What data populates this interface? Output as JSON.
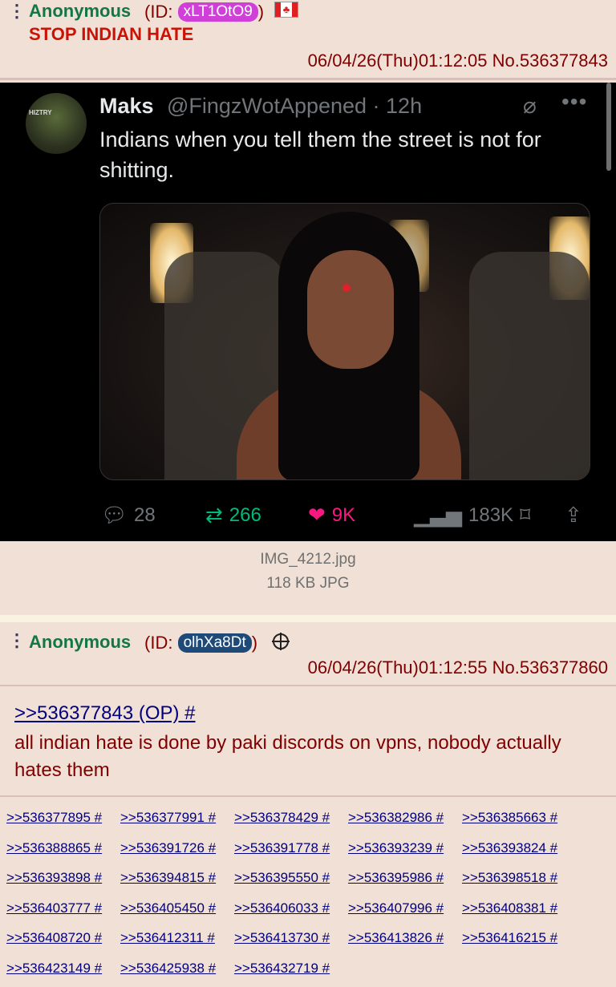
{
  "post1": {
    "menu": "⋮",
    "name": "Anonymous",
    "id_prefix": "(ID: ",
    "id": "xLT1OtO9",
    "id_suffix": ")",
    "id_color": "#d040d8",
    "flag": "Canada",
    "subject": "STOP INDIAN HATE",
    "datetime": "06/04/26(Thu)01:12:05",
    "number": "No.536377843",
    "file": {
      "name": "IMG_4212.jpg",
      "size": "118 KB JPG"
    },
    "tweet": {
      "name": "Maks",
      "handle": "@FingzWotAppened · 12h",
      "text": "Indians when you tell them the street is not for shitting.",
      "avatar_text": "HIZTRY",
      "replies": "28",
      "reposts": "266",
      "likes": "9K",
      "views": "183K",
      "like_color": "#f91880",
      "repost_color": "#00ba7c"
    }
  },
  "post2": {
    "menu": "⋮",
    "name": "Anonymous",
    "id_prefix": "(ID: ",
    "id": "olhXa8Dt",
    "id_suffix": ")",
    "id_color": "#1e4a7a",
    "datetime": "06/04/26(Thu)01:12:55",
    "number": "No.536377860",
    "quote": ">>536377843 (OP) #",
    "message": "all indian hate is done by paki discords on vpns, nobody actually hates them",
    "backlinks": [
      ">>536377895 #",
      ">>536377991 #",
      ">>536378429 #",
      ">>536382986 #",
      ">>536385663 #",
      ">>536388865 #",
      ">>536391726 #",
      ">>536391778 #",
      ">>536393239 #",
      ">>536393824 #",
      ">>536393898 #",
      ">>536394815 #",
      ">>536395550 #",
      ">>536395986 #",
      ">>536398518 #",
      ">>536403777 #",
      ">>536405450 #",
      ">>536406033 #",
      ">>536407996 #",
      ">>536408381 #",
      ">>536408720 #",
      ">>536412311 #",
      ">>536413730 #",
      ">>536413826 #",
      ">>536416215 #",
      ">>536423149 #",
      ">>536425938 #",
      ">>536432719 #"
    ]
  }
}
